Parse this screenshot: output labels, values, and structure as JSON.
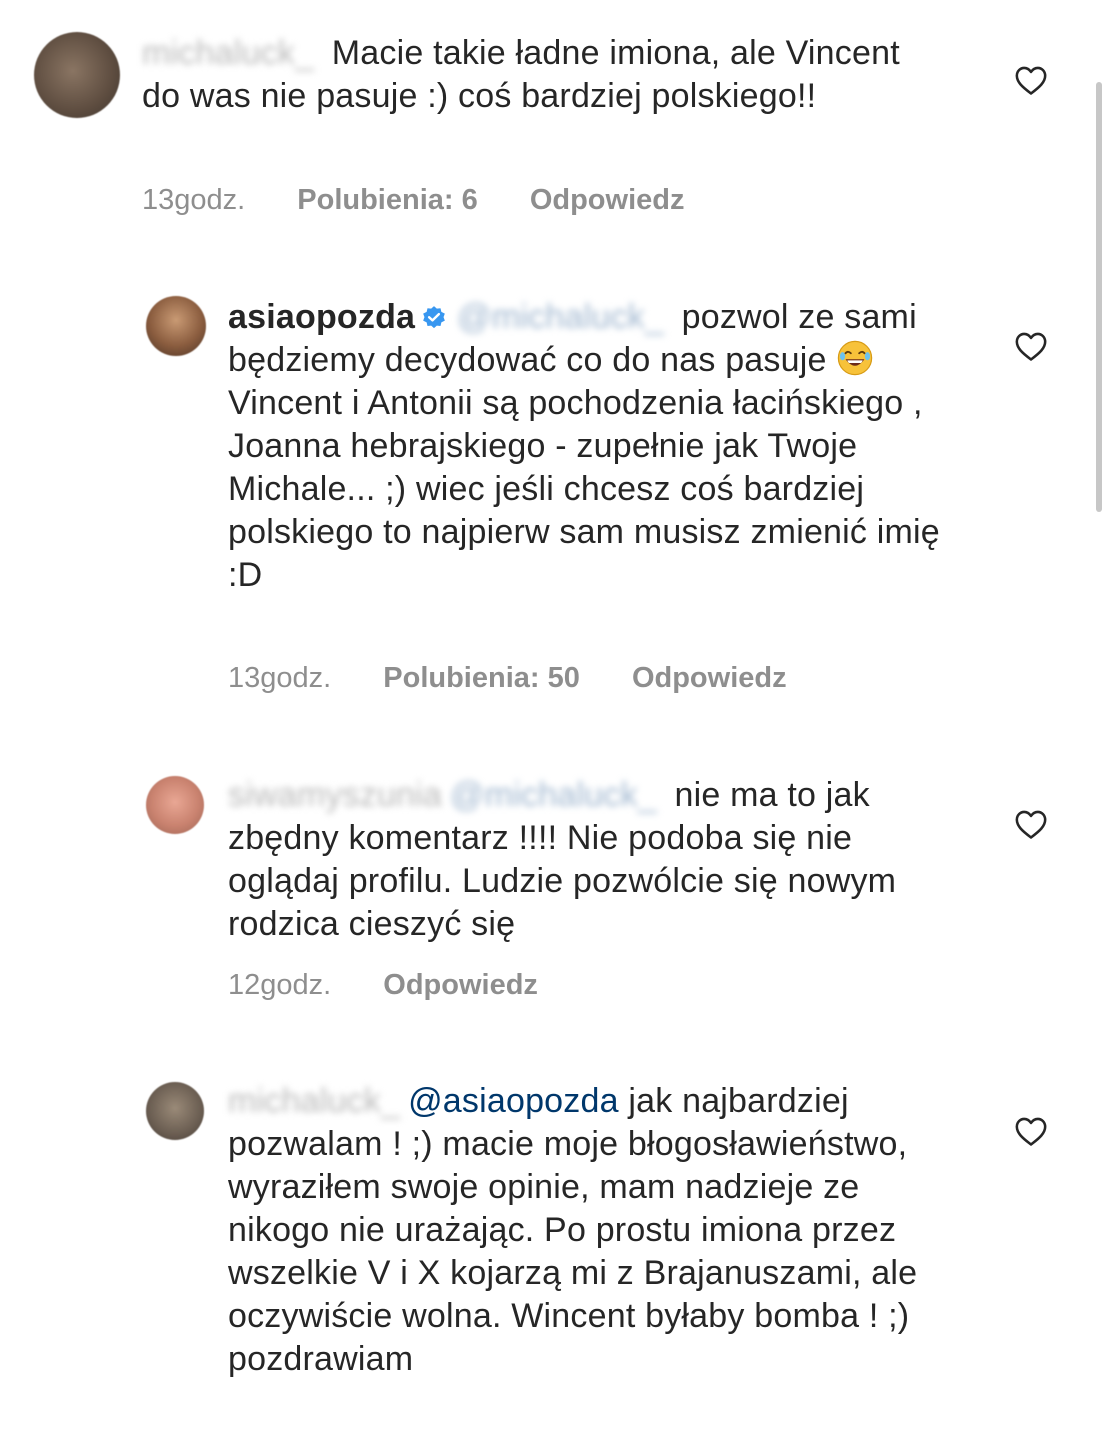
{
  "comments": [
    {
      "username": "michaluck_",
      "text": "Macie takie ładne imiona, ale Vincent do was nie pasuje :) coś bardziej polskiego!!",
      "time": "13godz.",
      "likes": "Polubienia: 6",
      "reply": "Odpowiedz"
    },
    {
      "username": "asiaopozda",
      "mention": "@michaluck_",
      "text_before_emoji": "pozwol ze sami będziemy decydować co do nas pasuje",
      "text_after_emoji": "Vincent i Antonii są pochodzenia łacińskiego , Joanna hebrajskiego - zupełnie jak Twoje Michale... ;) wiec jeśli chcesz coś bardziej polskiego to najpierw sam musisz zmienić imię :D",
      "time": "13godz.",
      "likes": "Polubienia: 50",
      "reply": "Odpowiedz"
    },
    {
      "username": "siwamyszunia",
      "mention": "@michaluck_",
      "text": "nie ma to jak zbędny komentarz !!!! Nie podoba się nie oglądaj profilu. Ludzie pozwólcie się nowym rodzica cieszyć się",
      "time": "12godz.",
      "reply": "Odpowiedz"
    },
    {
      "username": "michaluck_",
      "mention": "@asiaopozda",
      "text": "jak najbardziej pozwalam ! ;) macie moje błogosławieństwo, wyraziłem swoje opinie, mam nadzieje ze nikogo nie urażając. Po prostu imiona przez wszelkie V i X kojarzą mi z Brajanuszami, ale oczywiście wolna. Wincent byłaby bomba ! ;) pozdrawiam"
    }
  ],
  "colors": {
    "text": "#262626",
    "meta": "#8e8e8e",
    "mention": "#00376b",
    "verified": "#3897f0"
  },
  "icons": [
    "heart-icon",
    "verified-badge-icon",
    "laughing-emoji-icon"
  ]
}
